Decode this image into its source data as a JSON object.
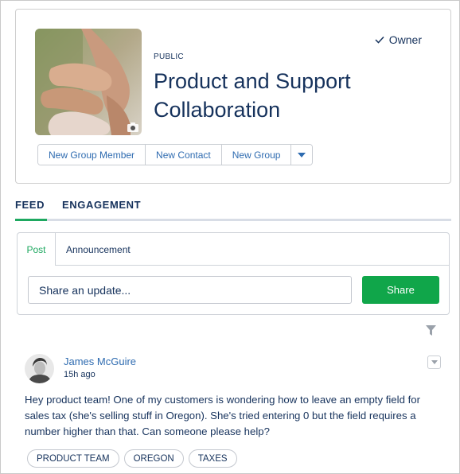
{
  "group": {
    "visibility": "PUBLIC",
    "title": "Product and Support Collaboration",
    "role": "Owner"
  },
  "actions": {
    "new_group_member": "New Group Member",
    "new_contact": "New Contact",
    "new_group": "New Group"
  },
  "tabs": {
    "feed": "FEED",
    "engagement": "ENGAGEMENT"
  },
  "publisher": {
    "tab_post": "Post",
    "tab_announcement": "Announcement",
    "input_placeholder": "Share an update...",
    "share_label": "Share"
  },
  "post": {
    "author": "James McGuire",
    "time": "15h ago",
    "body": "Hey product team! One of my customers is wondering how to leave an empty field for sales tax (she's selling stuff in Oregon). She's tried entering 0 but the field requires a number higher than that. Can someone please help?",
    "topics": [
      "PRODUCT TEAM",
      "OREGON",
      "TAXES"
    ]
  },
  "colors": {
    "accent_green": "#1ea860",
    "share_button": "#10a64a",
    "link_blue": "#2e6bb0",
    "text_navy": "#16325c"
  },
  "icons": [
    "camera-icon",
    "check-icon",
    "chevron-down-icon",
    "filter-icon"
  ]
}
